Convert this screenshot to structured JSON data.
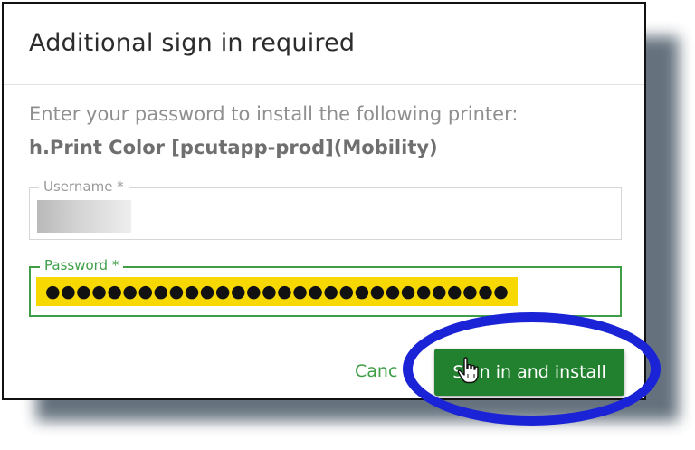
{
  "dialog": {
    "title": "Additional sign in required",
    "instruction": "Enter your password to install the following printer:",
    "printer_name": "h.Print Color [pcutapp-prod](Mobility)"
  },
  "form": {
    "username": {
      "label": "Username *",
      "value": ""
    },
    "password": {
      "label": "Password *",
      "masked_value": "●●●●●●●●●●●●●●●●●●●●●●●●●●●●●●"
    }
  },
  "actions": {
    "cancel_label": "Canc",
    "sign_in_label": "Sign in and install"
  },
  "colors": {
    "accent_green": "#3f9e47",
    "button_green": "#22812e",
    "highlight_yellow": "#f7d800",
    "annotation_blue": "#1a24d6"
  },
  "icons": {
    "cursor": "hand-pointer-icon"
  }
}
